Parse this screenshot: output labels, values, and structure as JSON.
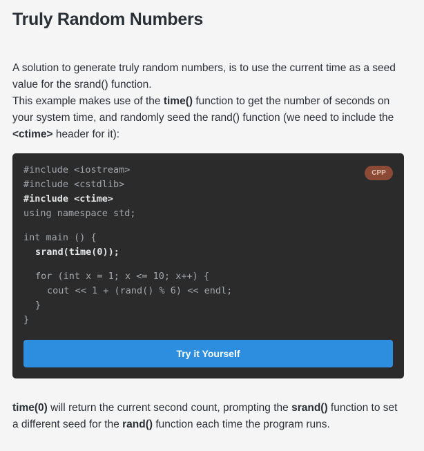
{
  "heading": "Truly Random Numbers",
  "intro": {
    "line1": "A solution to generate truly random numbers, is to use the current time as a seed value for the srand() function.",
    "line2_pre": "This example makes use of the ",
    "line2_bold1": "time()",
    "line2_mid": " function to get the number of seconds on your system time, and randomly seed the rand() function (we need to include the ",
    "line2_bold2": "<ctime>",
    "line2_post": " header for it):"
  },
  "example": {
    "language": "CPP",
    "code": {
      "l1": "#include <iostream>",
      "l2": "#include <cstdlib>",
      "l3": "#include <ctime>",
      "l4": "using namespace std;",
      "l5": "int main () {",
      "l6": "srand(time(0));",
      "l7": "for (int x = 1; x <= 10; x++) {",
      "l8": "cout << 1 + (rand() % 6) << endl;",
      "l9": "}",
      "l10": "}"
    },
    "button_label": "Try it Yourself"
  },
  "outro": {
    "b1": "time(0)",
    "t1": " will return the current second count, prompting the ",
    "b2": "srand()",
    "t2": " function to set a different seed for the ",
    "b3": "rand()",
    "t3": " function each time the program runs."
  },
  "colors": {
    "background": "#f5f5f5",
    "code_background": "#2b2b2b",
    "button": "#2d8ee0",
    "badge": "#8a4a36"
  }
}
